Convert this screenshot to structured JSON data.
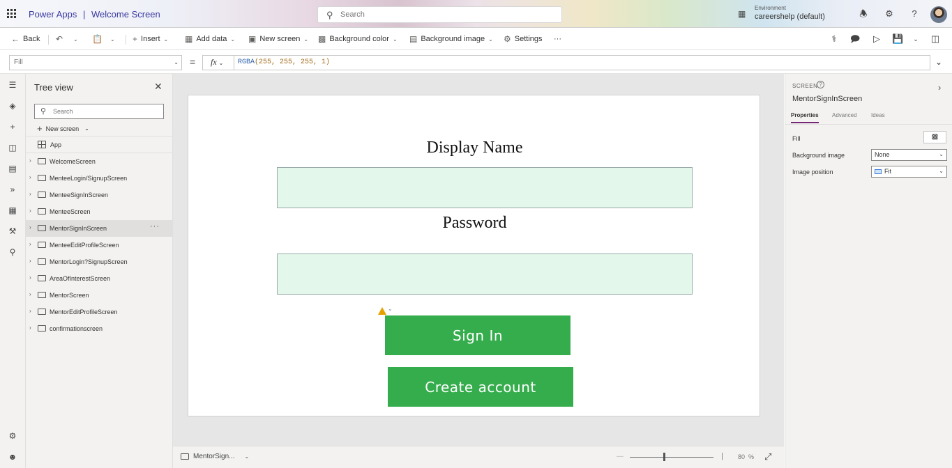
{
  "titlebar": {
    "app_name": "Power Apps",
    "separator": "|",
    "app_title": "Welcome Screen",
    "search_placeholder": "Search",
    "environment_label": "Environment",
    "environment_value": "careershelp (default)",
    "icons": [
      "waffle-icon",
      "search-icon",
      "environment-icon",
      "bell-icon",
      "gear-icon",
      "help-icon",
      "avatar"
    ]
  },
  "commandbar": {
    "back": "Back",
    "insert": "Insert",
    "add_data": "Add data",
    "new_screen": "New screen",
    "background_color": "Background color",
    "background_image": "Background image",
    "settings": "Settings",
    "more": "···"
  },
  "formulabar": {
    "property": "Fill",
    "equals": "=",
    "fx": "fx",
    "formula_fn": "RGBA",
    "formula_args": "(255, 255, 255, 1)"
  },
  "tree": {
    "title": "Tree view",
    "search_placeholder": "Search",
    "new_screen": "New screen",
    "app_item": "App",
    "screens": [
      "WelcomeScreen",
      "MenteeLogin/SignupScreen",
      "MenteeSignInScreen",
      "MenteeScreen",
      "MentorSignInScreen",
      "MenteeEditProfileScreen",
      "MentorLogin?SignupScreen",
      "AreaOfInterestScreen",
      "MentorScreen",
      "MentorEditProfileScreen",
      "confirmationscreen"
    ],
    "selected_index": 4,
    "row_more": "···"
  },
  "canvas": {
    "display_name_label": "Display Name",
    "password_label": "Password",
    "sign_in_button": "Sign In",
    "create_account_button": "Create account",
    "background_color": "#ffffff",
    "input_fill": "#e3f7ea",
    "button_color": "#35ad4c"
  },
  "statusbar": {
    "screen_name": "MentorSign...",
    "zoom_value": "80",
    "zoom_unit": "%"
  },
  "properties": {
    "type_label": "SCREEN",
    "screen_name": "MentorSignInScreen",
    "tabs": [
      "Properties",
      "Advanced",
      "Ideas"
    ],
    "active_tab": "Properties",
    "fill_label": "Fill",
    "background_image_label": "Background image",
    "background_image_value": "None",
    "image_position_label": "Image position",
    "image_position_value": "Fit"
  },
  "colors": {
    "accent": "#742774",
    "title_text": "#3b3aa0"
  }
}
